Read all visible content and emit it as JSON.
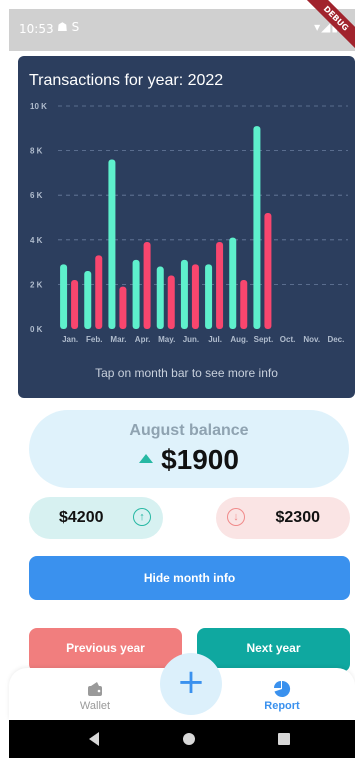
{
  "status_bar": {
    "time": "10:53",
    "left_icons": "☗ S",
    "right_icons": "▾◢▮",
    "debug_label": "DEBUG"
  },
  "chart": {
    "title": "Transactions for year: 2022",
    "hint": "Tap on month bar to see more info",
    "colors": {
      "income": "#5ef0cc",
      "expense": "#f9466e",
      "grid": "#6a7d9e",
      "label": "#b0bccd"
    }
  },
  "chart_data": {
    "type": "bar",
    "title": "Transactions for year: 2022",
    "categories": [
      "Jan.",
      "Feb.",
      "Mar.",
      "Apr.",
      "May.",
      "Jun.",
      "Jul.",
      "Aug.",
      "Sept.",
      "Oct.",
      "Nov.",
      "Dec."
    ],
    "series": [
      {
        "values": [
          2900,
          2600,
          7600,
          3100,
          2800,
          3100,
          2900,
          4100,
          9100,
          0,
          0,
          0
        ]
      },
      {
        "values": [
          2200,
          3300,
          1900,
          3900,
          2400,
          2900,
          3900,
          2200,
          5200,
          0,
          0,
          0
        ]
      }
    ],
    "yticks": [
      "0 K",
      "2 K",
      "4 K",
      "6 K",
      "8 K",
      "10 K"
    ],
    "ylim": [
      0,
      10000
    ],
    "grid": true
  },
  "balance": {
    "label": "August balance",
    "amount": "$1900",
    "trend": "up"
  },
  "income": {
    "value": "$4200",
    "icon": "arrow-up-circle-icon"
  },
  "expense": {
    "value": "$2300",
    "icon": "arrow-down-circle-icon"
  },
  "buttons": {
    "hide_month_info": "Hide month info",
    "previous_year": "Previous year",
    "next_year": "Next year",
    "add": "+"
  },
  "bottom_nav": {
    "wallet": "Wallet",
    "report": "Report"
  }
}
